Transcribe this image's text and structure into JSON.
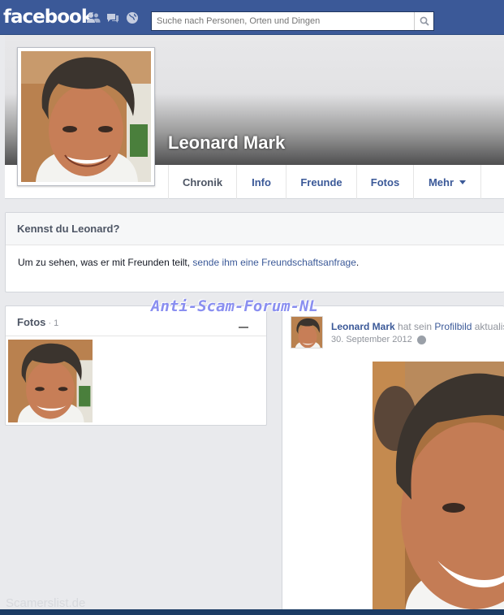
{
  "header": {
    "logo": "facebook",
    "search_placeholder": "Suche nach Personen, Orten und Dingen",
    "icons": [
      "friends-icon",
      "messages-icon",
      "notifications-globe-icon",
      "search-icon"
    ]
  },
  "profile": {
    "name": "Leonard Mark",
    "tabs": [
      {
        "label": "Chronik",
        "active": true
      },
      {
        "label": "Info"
      },
      {
        "label": "Freunde"
      },
      {
        "label": "Fotos"
      },
      {
        "label": "Mehr"
      }
    ]
  },
  "kennst": {
    "title": "Kennst du Leonard?",
    "text_prefix": "Um zu sehen, was er mit Freunden teilt, ",
    "link": "sende ihm eine Freundschaftsanfrage",
    "text_suffix": "."
  },
  "photos_box": {
    "title": "Fotos",
    "count_sep": " · ",
    "count": "1"
  },
  "post": {
    "author": "Leonard Mark",
    "verb": " hat sein ",
    "link": "Profilbild",
    "rest": " aktualisiert.",
    "date": "30. September 2012"
  },
  "overlays": {
    "watermark": "Anti-Scam-Forum-NL",
    "footer": "Scamerslist.de"
  },
  "colors": {
    "brand": "#3b5998",
    "background": "#e9eaed",
    "link": "#3b5998"
  }
}
